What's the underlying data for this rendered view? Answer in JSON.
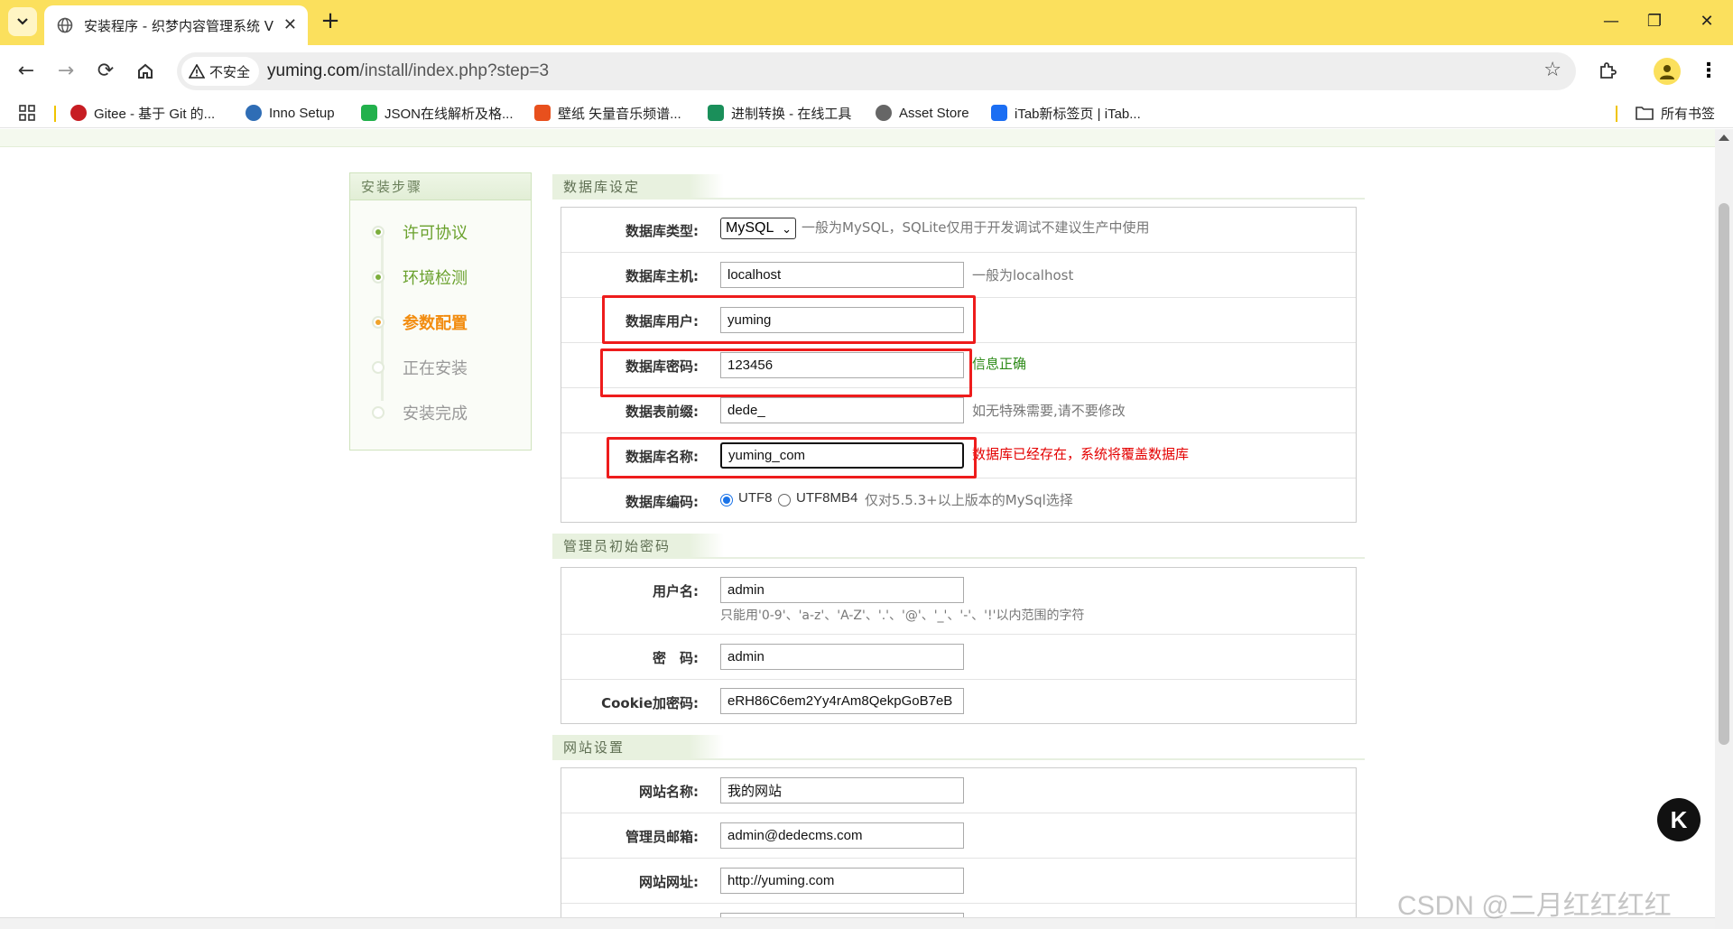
{
  "browser": {
    "tab_title": "安装程序 - 织梦内容管理系统 V",
    "security_label": "不安全",
    "url_host": "yuming.com",
    "url_path": "/install/index.php?step=3",
    "bookmarks": [
      {
        "label": "Gitee - 基于 Git 的...",
        "color": "#c71d23"
      },
      {
        "label": "Inno Setup",
        "color": "#2f6db5"
      },
      {
        "label": "JSON在线解析及格...",
        "color": "#22b14c"
      },
      {
        "label": "壁纸 矢量音乐频谱...",
        "color": "#e8501d"
      },
      {
        "label": "进制转换 - 在线工具",
        "color": "#1a8f5a"
      },
      {
        "label": "Asset Store",
        "color": "#666666"
      },
      {
        "label": "iTab新标签页 | iTab...",
        "color": "#1b6ef3"
      }
    ],
    "all_bookmarks_label": "所有书签"
  },
  "steps": {
    "header": "安装步骤",
    "items": [
      {
        "label": "许可协议",
        "state": "done"
      },
      {
        "label": "环境检测",
        "state": "done"
      },
      {
        "label": "参数配置",
        "state": "current"
      },
      {
        "label": "正在安装",
        "state": "pending"
      },
      {
        "label": "安装完成",
        "state": "pending"
      }
    ]
  },
  "db": {
    "title": "数据库设定",
    "type_label": "数据库类型:",
    "type_value": "MySQL",
    "type_hint": "一般为MySQL，SQLite仅用于开发调试不建议生产中使用",
    "host_label": "数据库主机:",
    "host_value": "localhost",
    "host_hint": "一般为localhost",
    "user_label": "数据库用户:",
    "user_value": "yuming",
    "pwd_label": "数据库密码:",
    "pwd_value": "123456",
    "pwd_hint": "信息正确",
    "prefix_label": "数据表前缀:",
    "prefix_value": "dede_",
    "prefix_hint": "如无特殊需要,请不要修改",
    "name_label": "数据库名称:",
    "name_value": "yuming_com",
    "name_hint": "数据库已经存在，系统将覆盖数据库",
    "charset_label": "数据库编码:",
    "charset_opt1": "UTF8",
    "charset_opt2": "UTF8MB4",
    "charset_hint": "仅对5.5.3+以上版本的MySql选择"
  },
  "admin": {
    "title": "管理员初始密码",
    "user_label": "用户名:",
    "user_value": "admin",
    "user_hint": "只能用'0-9'、'a-z'、'A-Z'、'.'、'@'、'_'、'-'、'!'以内范围的字符",
    "pwd_label": "密　码:",
    "pwd_value": "admin",
    "cookie_label": "Cookie加密码:",
    "cookie_value": "eRH86C6em2Yy4rAm8QekpGoB7eB"
  },
  "site": {
    "title": "网站设置",
    "name_label": "网站名称:",
    "name_value": "我的网站",
    "email_label": "管理员邮箱:",
    "email_value": "admin@dedecms.com",
    "url_label": "网站网址:",
    "url_value": "http://yuming.com"
  },
  "watermark": "CSDN @二月红红红红",
  "float_button": "K"
}
